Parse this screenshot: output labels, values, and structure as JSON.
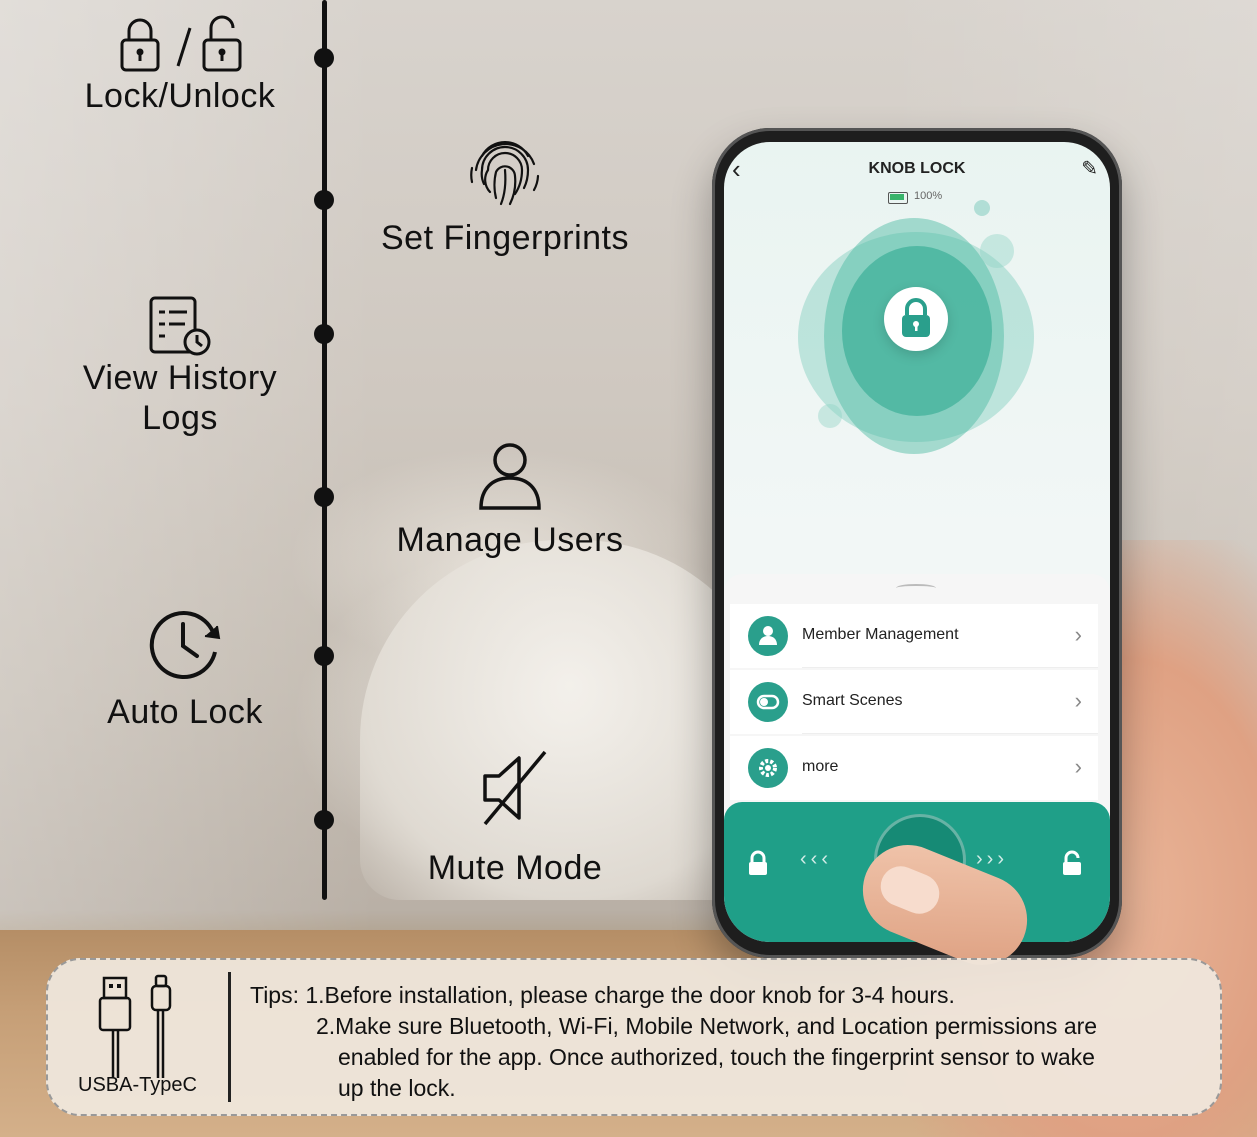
{
  "features": {
    "lock_unlock": "Lock/Unlock",
    "set_fingerprints": "Set Fingerprints",
    "view_history_logs_line1": "View History",
    "view_history_logs_line2": "Logs",
    "manage_users": "Manage Users",
    "auto_lock": "Auto Lock",
    "mute_mode": "Mute Mode"
  },
  "app": {
    "title": "KNOB LOCK",
    "battery": "100%",
    "menu": [
      {
        "label": "Member Management",
        "icon": "user-icon"
      },
      {
        "label": "Smart Scenes",
        "icon": "toggle-icon"
      },
      {
        "label": "more",
        "icon": "gear-icon"
      }
    ]
  },
  "tips": {
    "cable_label": "USBA-TypeC",
    "line1": "Tips: 1.Before installation, please charge the door knob for 3-4 hours.",
    "line2": "2.Make sure Bluetooth, Wi-Fi, Mobile Network, and Location permissions are",
    "line3": "enabled for the app. Once authorized, touch the fingerprint sensor to wake",
    "line4": "up the lock."
  },
  "colors": {
    "accent": "#1f9f88",
    "timeline": "#111111"
  }
}
